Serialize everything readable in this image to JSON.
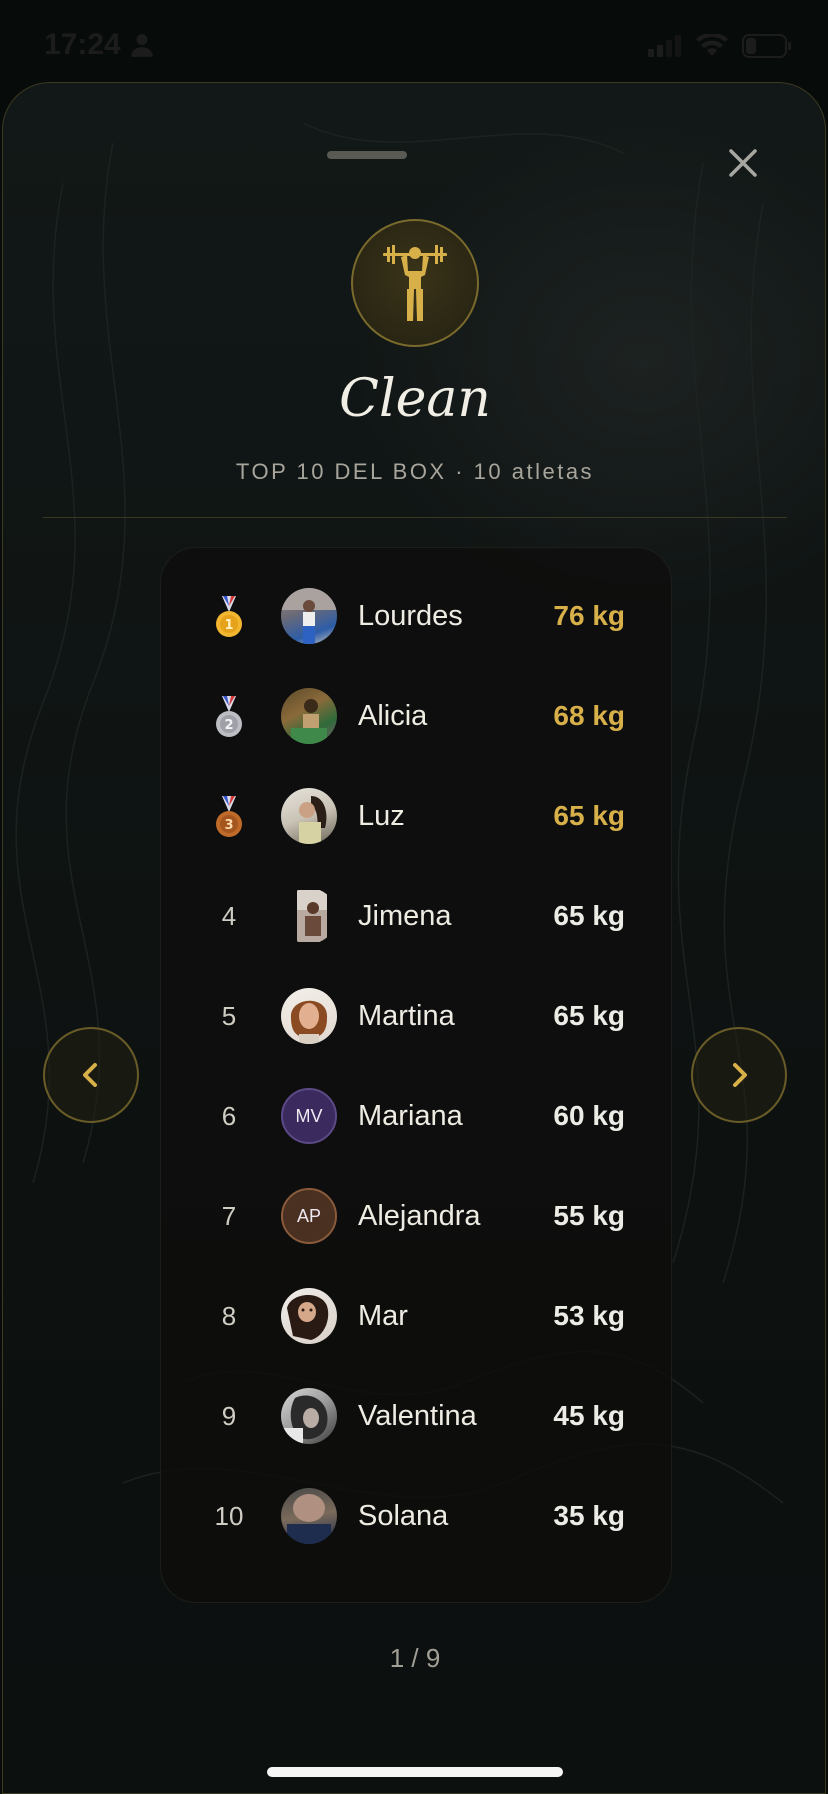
{
  "status_bar": {
    "time": "17:24"
  },
  "header": {
    "title": "Clean",
    "subtitle": "TOP 10 DEL BOX · 10 atletas",
    "badge_icon": "weightlifter-icon",
    "close_icon": "close-icon"
  },
  "colors": {
    "accent_gold": "#d8b04a",
    "sheet_bg": "#101615",
    "board_bg": "#0e0e0c"
  },
  "leaderboard": [
    {
      "rank": "1",
      "medal": "gold-medal-icon",
      "name": "Lourdes",
      "weight": "76 kg",
      "avatar": "photo"
    },
    {
      "rank": "2",
      "medal": "silver-medal-icon",
      "name": "Alicia",
      "weight": "68 kg",
      "avatar": "photo"
    },
    {
      "rank": "3",
      "medal": "bronze-medal-icon",
      "name": "Luz",
      "weight": "65 kg",
      "avatar": "photo"
    },
    {
      "rank": "4",
      "name": "Jimena",
      "weight": "65 kg",
      "avatar": "photo"
    },
    {
      "rank": "5",
      "name": "Martina",
      "weight": "65 kg",
      "avatar": "photo"
    },
    {
      "rank": "6",
      "name": "Mariana",
      "weight": "60 kg",
      "avatar": "MV"
    },
    {
      "rank": "7",
      "name": "Alejandra",
      "weight": "55 kg",
      "avatar": "AP"
    },
    {
      "rank": "8",
      "name": "Mar",
      "weight": "53 kg",
      "avatar": "photo"
    },
    {
      "rank": "9",
      "name": "Valentina",
      "weight": "45 kg",
      "avatar": "photo"
    },
    {
      "rank": "10",
      "name": "Solana",
      "weight": "35 kg",
      "avatar": "photo"
    }
  ],
  "navigation": {
    "prev_icon": "chevron-left-icon",
    "next_icon": "chevron-right-icon"
  },
  "pager": "1 / 9"
}
